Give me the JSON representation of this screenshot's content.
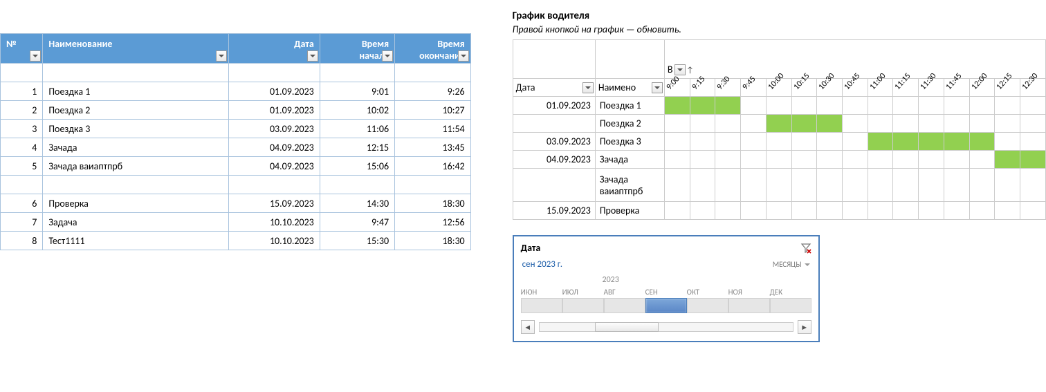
{
  "table": {
    "headers": {
      "no": "№",
      "name": "Наименование",
      "date": "Дата",
      "start_l1": "Время",
      "start_l2": "начала",
      "end_l1": "Время",
      "end_l2": "окончания"
    },
    "rows": [
      {
        "no": "1",
        "name": "Поездка 1",
        "date": "01.09.2023",
        "start": "9:01",
        "end": "9:26"
      },
      {
        "no": "2",
        "name": "Поездка 2",
        "date": "01.09.2023",
        "start": "10:02",
        "end": "10:27"
      },
      {
        "no": "3",
        "name": "Поездка 3",
        "date": "03.09.2023",
        "start": "11:06",
        "end": "11:54"
      },
      {
        "no": "4",
        "name": "Зачада",
        "date": "04.09.2023",
        "start": "12:15",
        "end": "13:45"
      },
      {
        "no": "5",
        "name": "Зачада ваиаптпрб",
        "date": "04.09.2023",
        "start": "15:06",
        "end": "16:42"
      },
      {
        "no": "6",
        "name": "Проверка",
        "date": "15.09.2023",
        "start": "14:30",
        "end": "18:30"
      },
      {
        "no": "7",
        "name": "Задача",
        "date": "10.10.2023",
        "start": "9:47",
        "end": "12:56"
      },
      {
        "no": "8",
        "name": "Тест1111",
        "date": "10.10.2023",
        "start": "15:30",
        "end": "18:30"
      }
    ]
  },
  "pivot": {
    "title": "График водителя",
    "hint": "Правой кнопкой на график — обновить.",
    "topcell": "В",
    "col_date": "Дата",
    "col_name": "Наимено",
    "times": [
      "9:00",
      "9:15",
      "9:30",
      "9:45",
      "10:00",
      "10:15",
      "10:30",
      "10:45",
      "11:00",
      "11:15",
      "11:30",
      "11:45",
      "12:00",
      "12:15",
      "12:30"
    ],
    "rows": [
      {
        "date": "01.09.2023",
        "name": "Поездка 1",
        "fill": [
          0,
          1,
          2
        ]
      },
      {
        "date": "",
        "name": "Поездка 2",
        "fill": [
          4,
          5,
          6
        ]
      },
      {
        "date": "03.09.2023",
        "name": "Поездка 3",
        "fill": [
          8,
          9,
          10,
          11,
          12
        ]
      },
      {
        "date": "04.09.2023",
        "name": "Зачада",
        "fill": [
          13,
          14
        ]
      },
      {
        "date": "",
        "name": "Зачада ваиаптпрб",
        "fill": [],
        "tall": true
      },
      {
        "date": "15.09.2023",
        "name": "Проверка",
        "fill": []
      }
    ]
  },
  "slicer": {
    "title": "Дата",
    "selected": "сен 2023 г.",
    "level": "МЕСЯЦЫ",
    "year": "2023",
    "months": [
      "ИЮН",
      "ИЮЛ",
      "АВГ",
      "СЕН",
      "ОКТ",
      "НОЯ",
      "ДЕК"
    ],
    "selected_idx": 3
  }
}
